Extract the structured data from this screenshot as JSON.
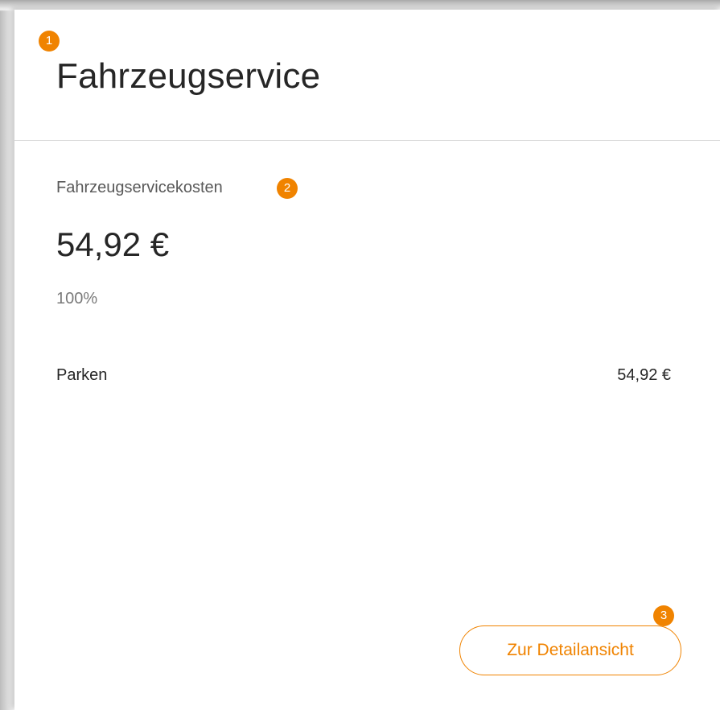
{
  "card": {
    "title": "Fahrzeugservice",
    "subtitle": "Fahrzeugservicekosten",
    "total": "54,92 €",
    "percent": "100%",
    "rows": [
      {
        "label": "Parken",
        "value": "54,92 €"
      }
    ],
    "detail_button_label": "Zur Detailansicht"
  },
  "badges": [
    "1",
    "2",
    "3"
  ],
  "colors": {
    "accent": "#f08300",
    "text_primary": "#262626",
    "text_secondary": "#595959",
    "divider": "#dcdcdc"
  }
}
